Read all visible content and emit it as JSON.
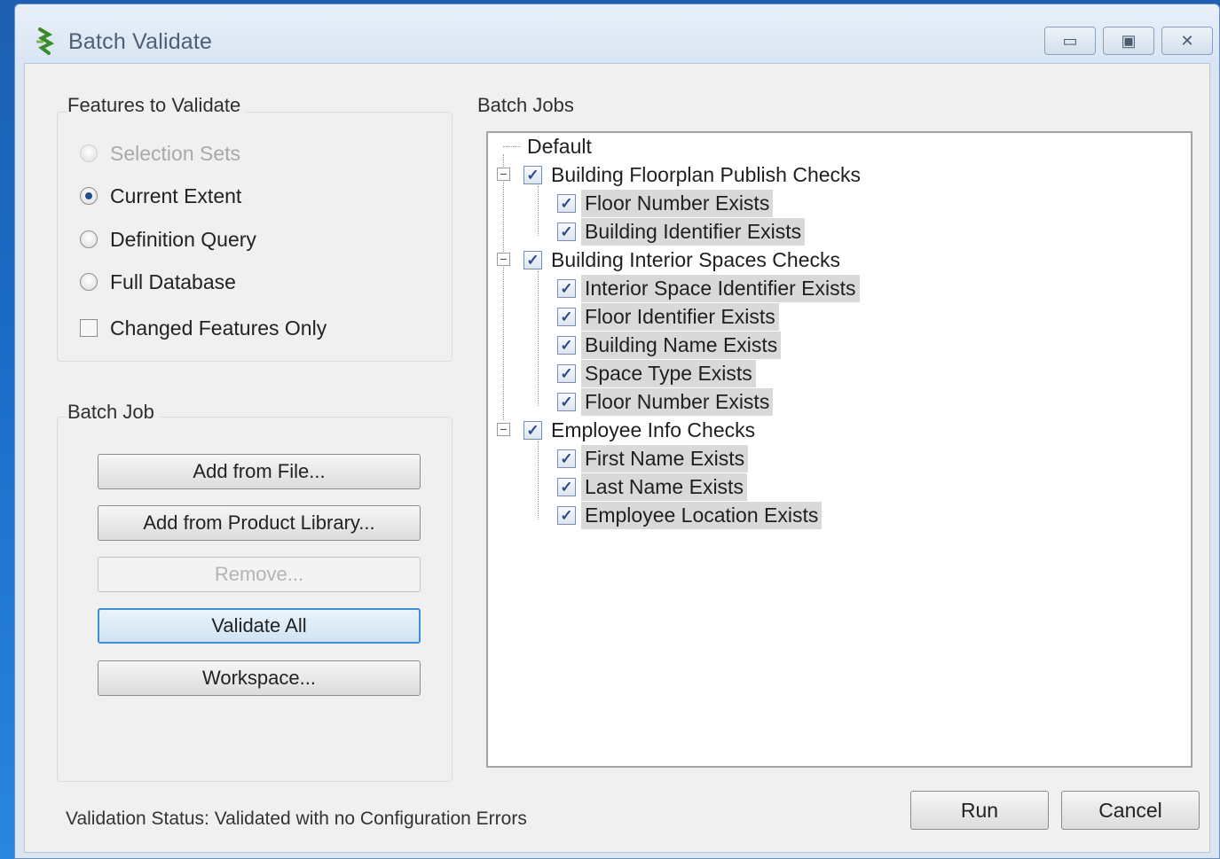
{
  "window": {
    "title": "Batch Validate",
    "controls": {
      "minimize": "▭",
      "maximize": "▣",
      "close": "✕"
    }
  },
  "features_group": {
    "label": "Features to Validate",
    "options": [
      {
        "label": "Selection Sets",
        "checked": false,
        "disabled": true
      },
      {
        "label": "Current Extent",
        "checked": true,
        "disabled": false
      },
      {
        "label": "Definition Query",
        "checked": false,
        "disabled": false
      },
      {
        "label": "Full Database",
        "checked": false,
        "disabled": false
      }
    ],
    "changed_only": {
      "label": "Changed Features Only",
      "checked": false
    }
  },
  "batch_job_group": {
    "label": "Batch Job",
    "buttons": {
      "add_from_file": "Add from File...",
      "add_from_library": "Add from Product Library...",
      "remove": "Remove...",
      "validate_all": "Validate All",
      "workspace": "Workspace..."
    }
  },
  "batch_jobs": {
    "label": "Batch Jobs",
    "root": "Default",
    "groups": [
      {
        "label": "Building Floorplan Publish Checks",
        "children": [
          "Floor Number Exists",
          "Building Identifier Exists"
        ]
      },
      {
        "label": "Building Interior Spaces Checks",
        "children": [
          "Interior Space Identifier Exists",
          "Floor Identifier Exists",
          "Building Name Exists",
          "Space Type Exists",
          "Floor Number Exists"
        ]
      },
      {
        "label": "Employee Info Checks",
        "children": [
          "First Name Exists",
          "Last Name Exists",
          "Employee Location Exists"
        ]
      }
    ],
    "check_glyph": "✓",
    "expander_glyph": "−"
  },
  "status": {
    "text": "Validation Status: Validated with no Configuration Errors"
  },
  "footer": {
    "run": "Run",
    "cancel": "Cancel"
  }
}
